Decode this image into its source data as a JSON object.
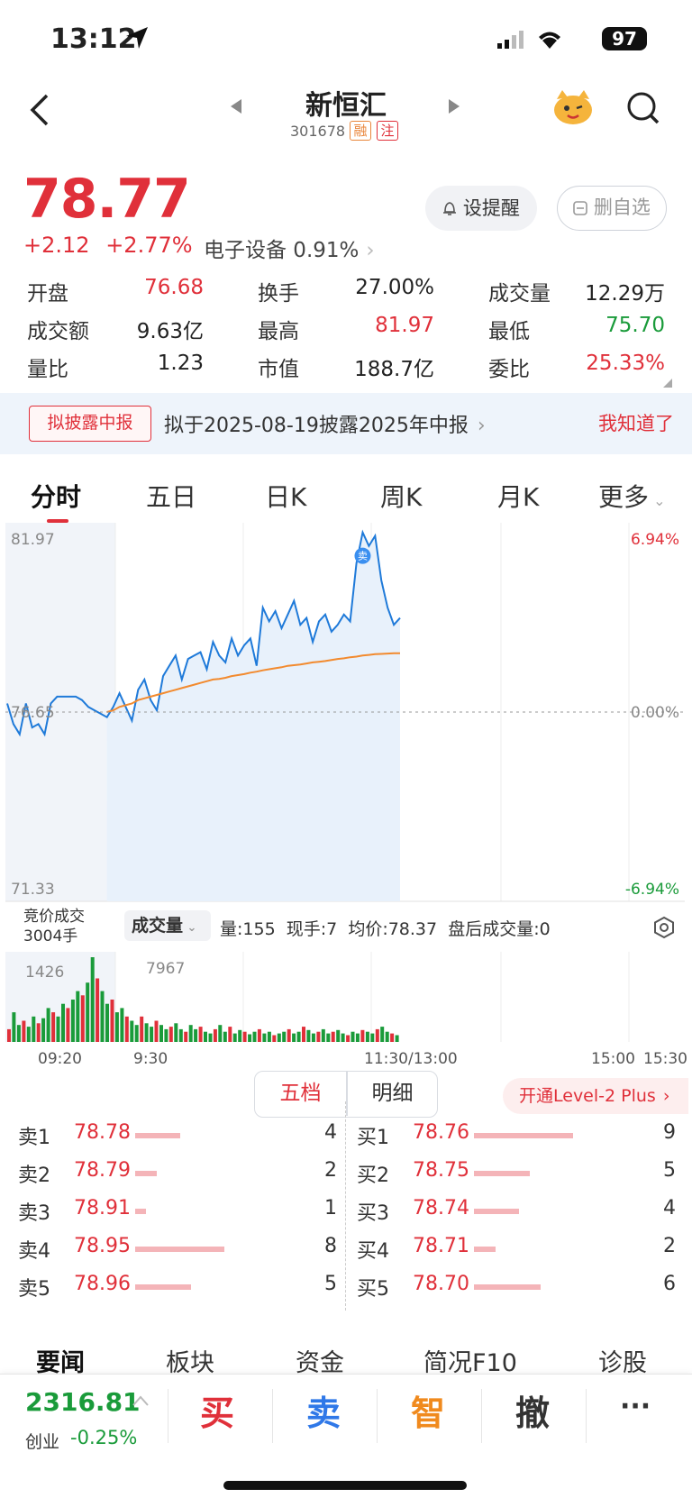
{
  "status_bar": {
    "time": "13:12",
    "battery": "97"
  },
  "nav": {
    "stock_name": "新恒汇",
    "stock_code": "301678",
    "tag_margin": "融",
    "tag_note": "注"
  },
  "quote": {
    "price": "78.77",
    "change": "+2.12",
    "change_pct": "+2.77%",
    "sector": "电子设备 0.91%",
    "remind_label": "设提醒",
    "remove_label": "删自选"
  },
  "stats": [
    {
      "label": "开盘",
      "value": "76.68",
      "color": "red"
    },
    {
      "label": "换手",
      "value": "27.00%",
      "color": "black"
    },
    {
      "label": "成交量",
      "value": "12.29万",
      "color": "black"
    },
    {
      "label": "成交额",
      "value": "9.63亿",
      "color": "black"
    },
    {
      "label": "最高",
      "value": "81.97",
      "color": "red"
    },
    {
      "label": "最低",
      "value": "75.70",
      "color": "green"
    },
    {
      "label": "量比",
      "value": "1.23",
      "color": "black"
    },
    {
      "label": "市值",
      "value": "188.7亿",
      "color": "black"
    },
    {
      "label": "委比",
      "value": "25.33%",
      "color": "red"
    }
  ],
  "notice": {
    "tag": "拟披露中报",
    "text": "拟于2025-08-19披露2025年中报",
    "dismiss": "我知道了"
  },
  "chart_tabs": [
    "分时",
    "五日",
    "日K",
    "周K",
    "月K",
    "更多"
  ],
  "chart_data": {
    "type": "line",
    "y_left_ticks": [
      "81.97",
      "76.65",
      "71.33"
    ],
    "y_right_ticks": [
      "6.94%",
      "0.00%",
      "-6.94%"
    ],
    "ylim": [
      71.33,
      81.97
    ],
    "prev_close": 76.65,
    "x_ticks": [
      "09:20",
      "9:30",
      "11:30/13:00",
      "15:00",
      "15:30"
    ],
    "series": [
      {
        "values": [
          76.9,
          76.3,
          76.0,
          76.9,
          76.2,
          76.3,
          76.0,
          76.9,
          77.1,
          77.1,
          77.1,
          77.1,
          77.0,
          76.8,
          76.7,
          76.6,
          76.5,
          76.8,
          77.2,
          76.8,
          76.4,
          77.3,
          77.6,
          77.0,
          76.7,
          77.7,
          78.0,
          78.3,
          77.6,
          78.2,
          78.3,
          78.4,
          77.9,
          78.7,
          78.3,
          78.1,
          78.8,
          78.3,
          78.6,
          78.8,
          78.0,
          79.7,
          79.3,
          79.6,
          79.1,
          79.5,
          79.9,
          79.2,
          79.4,
          78.7,
          79.3,
          79.5,
          79.0,
          79.2,
          79.5,
          79.3,
          81.0,
          81.9,
          81.5,
          81.8,
          80.5,
          79.7,
          79.2,
          79.4
        ]
      },
      {
        "values": [
          76.65,
          76.65,
          76.65,
          76.65,
          76.65,
          76.65,
          76.65,
          76.65,
          76.65,
          76.65,
          76.65,
          76.65,
          76.65,
          76.65,
          76.65,
          76.65,
          76.65,
          76.7,
          76.8,
          76.85,
          76.9,
          77.0,
          77.05,
          77.1,
          77.15,
          77.2,
          77.25,
          77.3,
          77.35,
          77.4,
          77.45,
          77.5,
          77.55,
          77.6,
          77.62,
          77.65,
          77.7,
          77.73,
          77.76,
          77.8,
          77.83,
          77.87,
          77.9,
          77.93,
          77.96,
          78.0,
          78.02,
          78.04,
          78.07,
          78.1,
          78.12,
          78.14,
          78.17,
          78.2,
          78.22,
          78.25,
          78.27,
          78.3,
          78.32,
          78.34,
          78.35,
          78.36,
          78.37,
          78.37
        ]
      }
    ],
    "sell_marker": "卖"
  },
  "volume": {
    "auction_label": "竞价成交",
    "auction_value": "3004手",
    "selector": "成交量",
    "info": "量:155  现手:7  均价:78.37  盘后成交量:0",
    "left_value": "1426",
    "peak_value": "7967",
    "bars": [
      0.15,
      0.35,
      0.2,
      0.25,
      0.18,
      0.3,
      0.22,
      0.28,
      0.4,
      0.35,
      0.3,
      0.45,
      0.4,
      0.5,
      0.6,
      0.55,
      0.7,
      1.0,
      0.75,
      0.6,
      0.45,
      0.5,
      0.35,
      0.4,
      0.3,
      0.25,
      0.2,
      0.3,
      0.22,
      0.18,
      0.25,
      0.2,
      0.15,
      0.18,
      0.22,
      0.15,
      0.12,
      0.2,
      0.15,
      0.18,
      0.12,
      0.1,
      0.15,
      0.2,
      0.12,
      0.18,
      0.1,
      0.14,
      0.12,
      0.09,
      0.12,
      0.15,
      0.1,
      0.12,
      0.08,
      0.1,
      0.12,
      0.15,
      0.1,
      0.12,
      0.18,
      0.14,
      0.1,
      0.12,
      0.15,
      0.1,
      0.12,
      0.14,
      0.1,
      0.08,
      0.12,
      0.1,
      0.14,
      0.12,
      0.1,
      0.15,
      0.18,
      0.12,
      0.1,
      0.08
    ]
  },
  "order_book": {
    "tab_five": "五档",
    "tab_detail": "明细",
    "level2": "开通Level-2 Plus",
    "asks": [
      {
        "label": "卖1",
        "price": "78.78",
        "qty": "4",
        "bar": 0.45
      },
      {
        "label": "卖2",
        "price": "78.79",
        "qty": "2",
        "bar": 0.22
      },
      {
        "label": "卖3",
        "price": "78.91",
        "qty": "1",
        "bar": 0.11
      },
      {
        "label": "卖4",
        "price": "78.95",
        "qty": "8",
        "bar": 0.9
      },
      {
        "label": "卖5",
        "price": "78.96",
        "qty": "5",
        "bar": 0.56
      }
    ],
    "bids": [
      {
        "label": "买1",
        "price": "78.76",
        "qty": "9",
        "bar": 1.0
      },
      {
        "label": "买2",
        "price": "78.75",
        "qty": "5",
        "bar": 0.56
      },
      {
        "label": "买3",
        "price": "78.74",
        "qty": "4",
        "bar": 0.45
      },
      {
        "label": "买4",
        "price": "78.71",
        "qty": "2",
        "bar": 0.22
      },
      {
        "label": "买5",
        "price": "78.70",
        "qty": "6",
        "bar": 0.67
      }
    ]
  },
  "news_tabs": [
    "要闻",
    "板块",
    "资金",
    "简况F10",
    "诊股"
  ],
  "bottom": {
    "index_value": "2316.81",
    "index_name": "创业",
    "index_change": "-0.25%",
    "buy": "买",
    "sell": "卖",
    "smart": "智",
    "cancel": "撤",
    "more": "···"
  }
}
